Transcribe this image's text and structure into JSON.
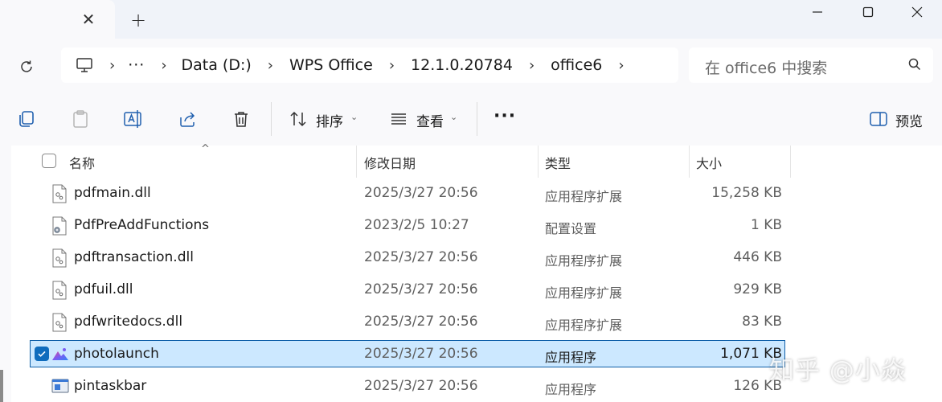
{
  "window": {
    "controls": {
      "minimize": "—",
      "maximize": "☐",
      "close": "✕"
    }
  },
  "tabbar": {
    "close_glyph": "✕",
    "new_tab_glyph": "+"
  },
  "breadcrumb": {
    "overflow": "···",
    "segments": [
      "Data (D:)",
      "WPS Office",
      "12.1.0.20784",
      "office6"
    ],
    "separator": "›"
  },
  "search": {
    "placeholder": "在 office6 中搜索"
  },
  "toolbar": {
    "sort_label": "排序",
    "view_label": "查看",
    "more_label": "···",
    "preview_label": "预览",
    "caret": "⌄"
  },
  "columns": {
    "name": "名称",
    "date": "修改日期",
    "type": "类型",
    "size": "大小",
    "sort_indicator": "^"
  },
  "files": [
    {
      "name": "pdfmain.dll",
      "date": "2025/3/27 20:56",
      "type": "应用程序扩展",
      "size": "15,258 KB",
      "icon": "dll-file-icon",
      "selected": false
    },
    {
      "name": "PdfPreAddFunctions",
      "date": "2023/2/5 10:27",
      "type": "配置设置",
      "size": "1 KB",
      "icon": "config-file-icon",
      "selected": false
    },
    {
      "name": "pdftransaction.dll",
      "date": "2025/3/27 20:56",
      "type": "应用程序扩展",
      "size": "446 KB",
      "icon": "dll-file-icon",
      "selected": false
    },
    {
      "name": "pdfuil.dll",
      "date": "2025/3/27 20:56",
      "type": "应用程序扩展",
      "size": "929 KB",
      "icon": "dll-file-icon",
      "selected": false
    },
    {
      "name": "pdfwritedocs.dll",
      "date": "2025/3/27 20:56",
      "type": "应用程序扩展",
      "size": "83 KB",
      "icon": "dll-file-icon",
      "selected": false
    },
    {
      "name": "photolaunch",
      "date": "2025/3/27 20:56",
      "type": "应用程序",
      "size": "1,071 KB",
      "icon": "photo-app-icon",
      "selected": true
    },
    {
      "name": "pintaskbar",
      "date": "2025/3/27 20:56",
      "type": "应用程序",
      "size": "126 KB",
      "icon": "app-window-icon",
      "selected": false
    }
  ],
  "watermark": "知乎 @小焱",
  "colors": {
    "selection": "#cce8ff",
    "accent": "#0f6cbd",
    "chrome": "#f9f9fb"
  }
}
